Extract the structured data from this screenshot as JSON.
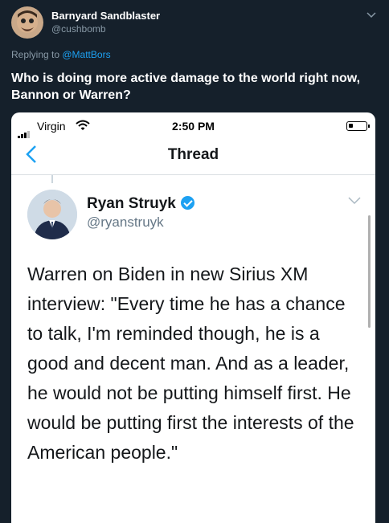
{
  "author": {
    "name": "Barnyard Sandblaster",
    "handle": "@cushbomb"
  },
  "reply": {
    "prefix": "Replying to ",
    "mention": "@MattBors"
  },
  "tweet": {
    "text": "Who is doing more active damage to the world right now, Bannon or Warren?"
  },
  "screenshot": {
    "status_bar": {
      "carrier": "Virgin",
      "time": "2:50 PM"
    },
    "nav": {
      "back_icon": "chevron-left-icon",
      "title": "Thread"
    },
    "quoted_tweet": {
      "name": "Ryan Struyk",
      "handle": "@ryanstruyk",
      "verified": true,
      "text": "Warren on Biden in new Sirius XM interview: \"Every time he has a chance to talk, I'm reminded though, he is a good and decent man. And as a leader, he would not be putting himself first. He would be putting first the interests of the American people.\""
    }
  },
  "colors": {
    "background": "#15202b",
    "accent": "#1da1f2",
    "muted": "#8899a6"
  }
}
